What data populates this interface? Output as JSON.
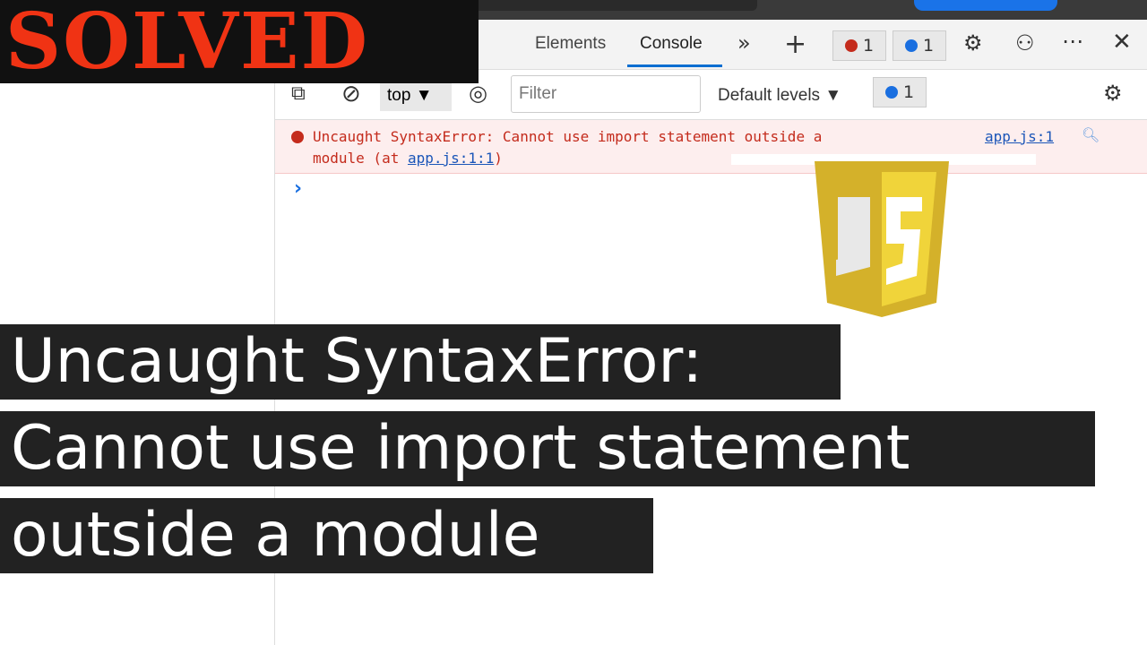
{
  "banner": {
    "text": "SOLVED"
  },
  "devtools": {
    "tabs": [
      {
        "label": "Elements"
      },
      {
        "label": "Console",
        "active": true
      }
    ],
    "error_count": "1",
    "message_count": "1",
    "toolbar": {
      "context": "top",
      "filter_placeholder": "Filter",
      "levels": "Default levels",
      "issues_count": "1"
    },
    "error": {
      "text": "Uncaught SyntaxError: Cannot use import statement outside a",
      "text2": "module (at ",
      "link": "app.js:1:1",
      "close": ")",
      "source": "app.js:1"
    },
    "prompt": "›"
  },
  "logo": {
    "text": "JS",
    "color": "#f0d43a"
  },
  "caption": {
    "line1": "Uncaught SyntaxError:",
    "line2": "Cannot use import statement",
    "line3": "outside a module"
  },
  "colors": {
    "banner": "#f03314",
    "error_bg": "#fdeeee",
    "accent": "#0a6ed1"
  }
}
